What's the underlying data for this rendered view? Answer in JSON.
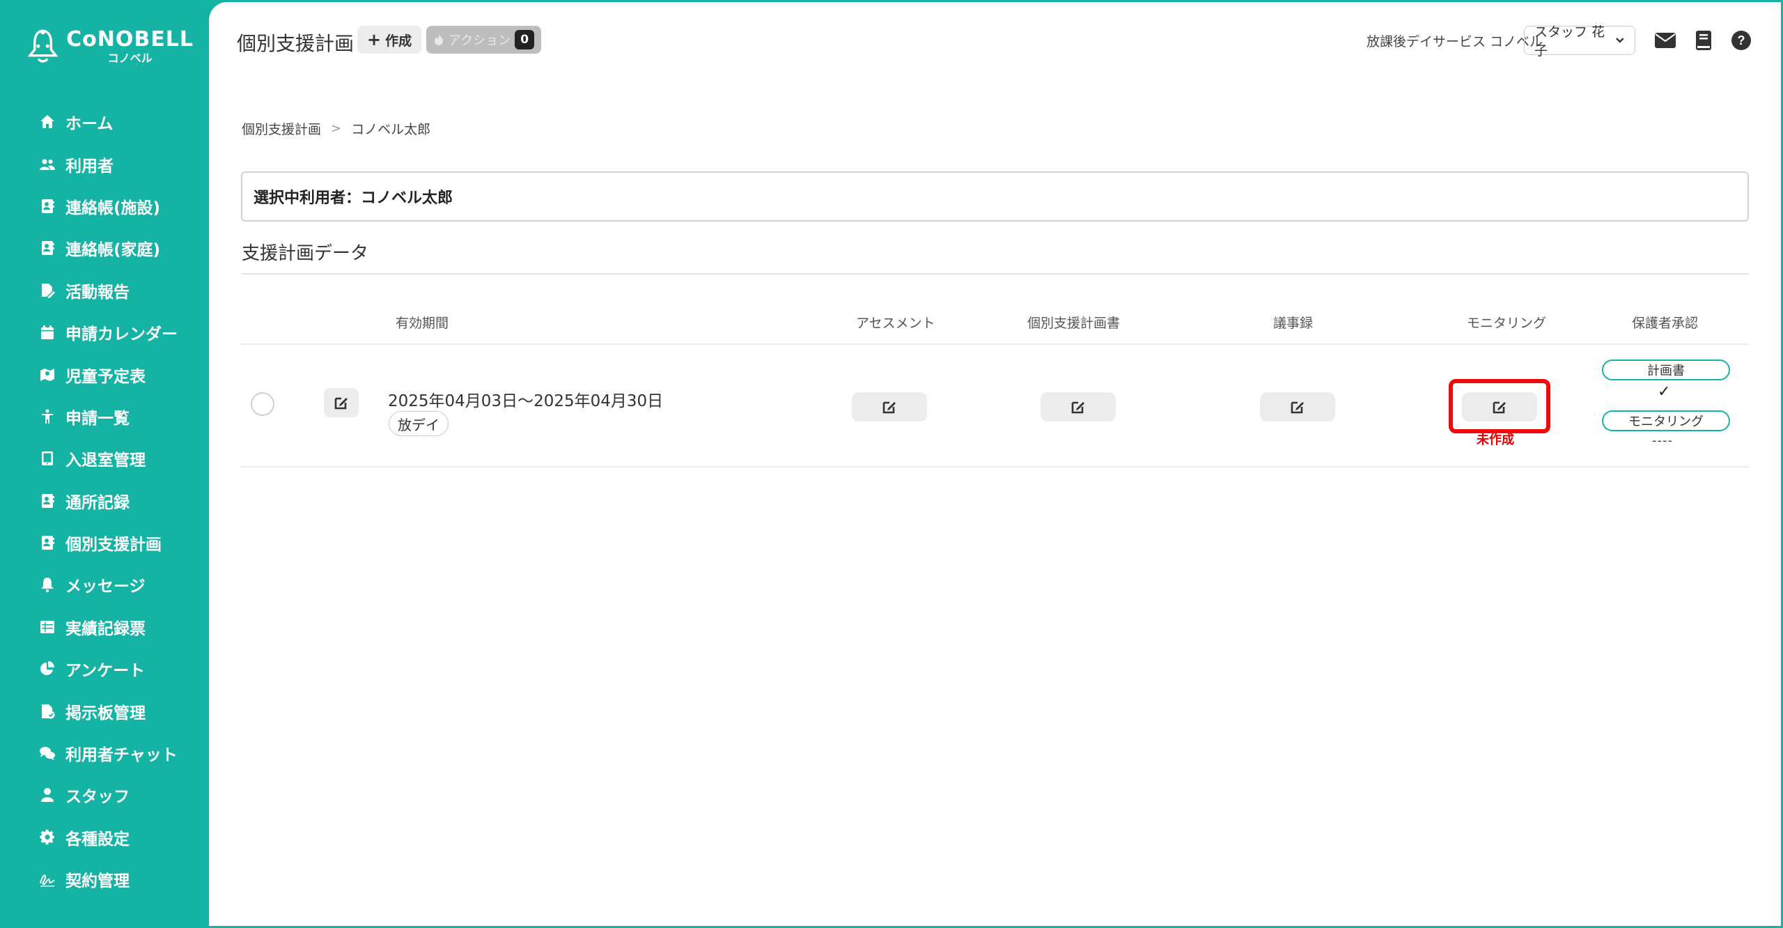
{
  "app": {
    "logo_main": "CoNOBELL",
    "logo_sub": "コノベル"
  },
  "sidebar": {
    "items": [
      {
        "label": "ホーム",
        "icon": "home-icon"
      },
      {
        "label": "利用者",
        "icon": "users-icon"
      },
      {
        "label": "連絡帳(施設)",
        "icon": "contact-book-icon"
      },
      {
        "label": "連絡帳(家庭)",
        "icon": "contact-book-icon"
      },
      {
        "label": "活動報告",
        "icon": "file-edit-icon"
      },
      {
        "label": "申請カレンダー",
        "icon": "calendar-icon"
      },
      {
        "label": "児童予定表",
        "icon": "map-icon"
      },
      {
        "label": "申請一覧",
        "icon": "child-icon"
      },
      {
        "label": "入退室管理",
        "icon": "tablet-icon"
      },
      {
        "label": "通所記録",
        "icon": "contact-book-icon"
      },
      {
        "label": "個別支援計画",
        "icon": "contact-book-icon"
      },
      {
        "label": "メッセージ",
        "icon": "bell-icon"
      },
      {
        "label": "実績記録票",
        "icon": "table-icon"
      },
      {
        "label": "アンケート",
        "icon": "pie-chart-icon"
      },
      {
        "label": "掲示板管理",
        "icon": "file-check-icon"
      },
      {
        "label": "利用者チャット",
        "icon": "chat-icon"
      },
      {
        "label": "スタッフ",
        "icon": "user-icon"
      },
      {
        "label": "各種設定",
        "icon": "gear-icon"
      },
      {
        "label": "契約管理",
        "icon": "signature-icon"
      }
    ]
  },
  "header": {
    "title": "個別支援計画",
    "create_label": "作成",
    "action_label": "アクション",
    "action_count": "0",
    "facility": "放課後デイサービス コノベル",
    "staff": "スタッフ 花子"
  },
  "breadcrumb": {
    "parent": "個別支援計画",
    "current": "コノベル太郎"
  },
  "selected_user": "選択中利用者：コノベル太郎",
  "section_title": "支援計画データ",
  "table": {
    "headers": {
      "period": "有効期間",
      "assessment": "アセスメント",
      "plan": "個別支援計画書",
      "minutes": "議事録",
      "monitoring": "モニタリング",
      "approval": "保護者承認"
    },
    "rows": [
      {
        "period": "2025年04月03日〜2025年04月30日",
        "service": "放デイ",
        "monitoring_status": "未作成",
        "approval_plan_label": "計画書",
        "approval_plan_value": "✓",
        "approval_monitoring_label": "モニタリング",
        "approval_monitoring_value": "----"
      }
    ]
  },
  "colors": {
    "brand": "#14b3a3",
    "highlight": "#f20a0a",
    "warning_text": "#e00000"
  }
}
